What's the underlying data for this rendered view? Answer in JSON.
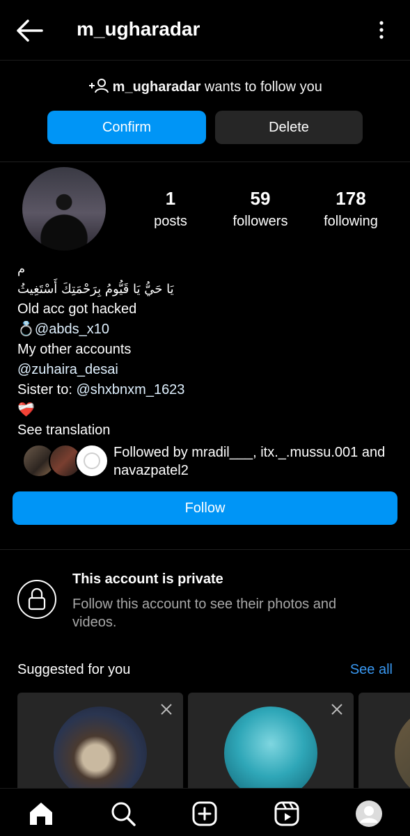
{
  "header": {
    "title": "m_ugharadar"
  },
  "follow_request": {
    "username": "m_ugharadar",
    "text_suffix": " wants to follow you",
    "confirm_label": "Confirm",
    "delete_label": "Delete"
  },
  "stats": [
    {
      "value": "1",
      "label": "posts"
    },
    {
      "value": "59",
      "label": "followers"
    },
    {
      "value": "178",
      "label": "following"
    }
  ],
  "bio": {
    "line1": "م",
    "line2": "يَا حَيُّ يَا قَيُّومُ بِرَحْمَتِكَ أَسْتَغِيثُ",
    "line3": "Old acc got hacked",
    "line4_emoji": "💍",
    "line4_handle": "@abds_x10",
    "line5": "My other accounts",
    "line6": "@zuhaira_desai",
    "line7_prefix": "Sister to: ",
    "line7_handle": "@shxbnxm_1623",
    "line8_emoji": "❤️‍🩹",
    "see_translation": "See translation"
  },
  "followed_by": {
    "text": "Followed by mradil___, itx._.mussu.001 and navazpatel2"
  },
  "follow_button": "Follow",
  "private": {
    "title": "This account is private",
    "subtitle": "Follow this account to see their photos and videos."
  },
  "suggested": {
    "title": "Suggested for you",
    "see_all": "See all"
  },
  "icons": {
    "back": "arrow-left-icon",
    "more": "more-vertical-icon",
    "add_person": "add-person-icon",
    "lock": "lock-icon",
    "home": "home-icon",
    "search": "search-icon",
    "create": "plus-square-icon",
    "reels": "reels-icon",
    "profile": "profile-avatar-icon"
  },
  "colors": {
    "accent": "#0095f6",
    "link": "#e0f1ff",
    "see_all": "#3897f0",
    "muted": "#a8a8a8",
    "dark_button": "#262626"
  }
}
